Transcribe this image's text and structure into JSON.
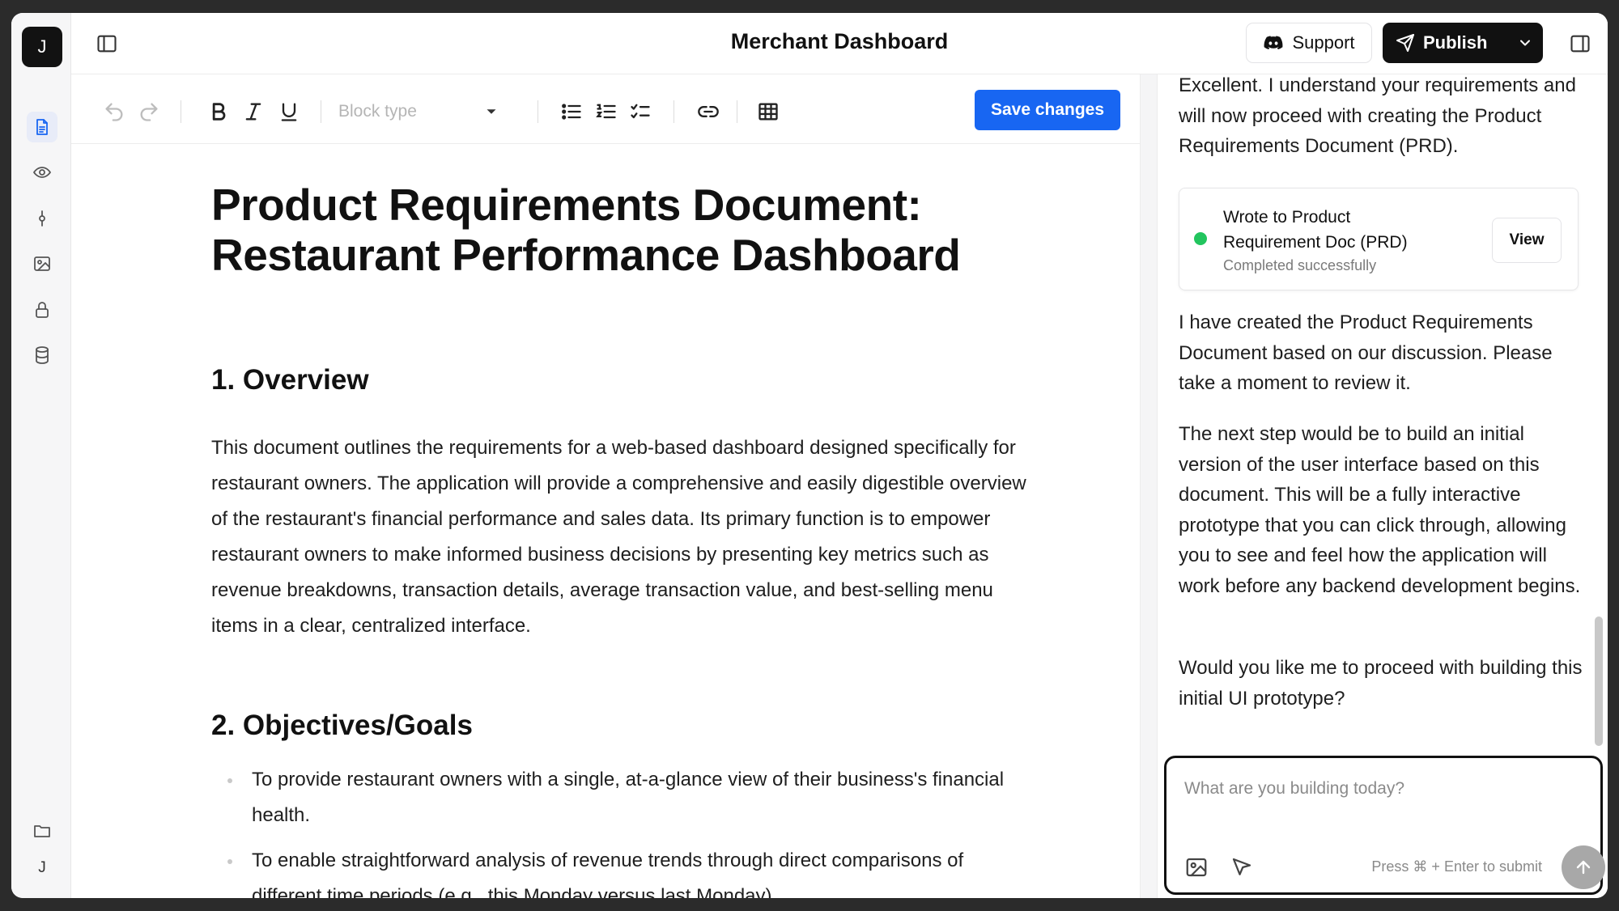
{
  "app": {
    "title": "Merchant Dashboard",
    "user_initial_top": "J",
    "user_initial_bottom": "J",
    "accent_color": "#1866f2"
  },
  "rail": {
    "items": [
      {
        "name": "document-icon",
        "active": true
      },
      {
        "name": "eye-icon",
        "active": false
      },
      {
        "name": "commit-icon",
        "active": false
      },
      {
        "name": "image-icon",
        "active": false
      },
      {
        "name": "lock-icon",
        "active": false
      },
      {
        "name": "database-icon",
        "active": false
      },
      {
        "name": "folder-icon",
        "active": false
      }
    ]
  },
  "header": {
    "support_label": "Support",
    "publish_label": "Publish"
  },
  "toolbar": {
    "block_type_placeholder": "Block type",
    "save_label": "Save changes"
  },
  "document": {
    "title": "Product Requirements Document: Restaurant Performance Dashboard",
    "section1_heading": "1. Overview",
    "section1_body": "This document outlines the requirements for a web-based dashboard designed specifically for restaurant owners. The application will provide a comprehensive and easily digestible overview of the restaurant's financial performance and sales data. Its primary function is to empower restaurant owners to make informed business decisions by presenting key metrics such as revenue breakdowns, transaction details, average transaction value, and best-selling menu items in a clear, centralized interface.",
    "section2_heading": "2. Objectives/Goals",
    "section2_bullets": [
      "To provide restaurant owners with a single, at-a-glance view of their business's financial health.",
      "To enable straightforward analysis of revenue trends through direct comparisons of different time periods (e.g., this Monday versus last Monday)."
    ]
  },
  "chat": {
    "message1": "Excellent. I understand your requirements and will now proceed with creating the Product Requirements Document (PRD).",
    "tool_call": {
      "title": "Wrote to Product Requirement Doc (PRD)",
      "status": "Completed successfully",
      "view_label": "View",
      "status_color": "#22c55e"
    },
    "message2": "I have created the Product Requirements Document based on our discussion. Please take a moment to review it.",
    "message3": "The next step would be to build an initial version of the user interface based on this document. This will be a fully interactive prototype that you can click through, allowing you to see and feel how the application will work before any backend development begins.",
    "message4": "Would you like me to proceed with building this initial UI prototype?",
    "composer_placeholder": "What are you building today?",
    "submit_hint": "Press ⌘ + Enter to submit"
  }
}
